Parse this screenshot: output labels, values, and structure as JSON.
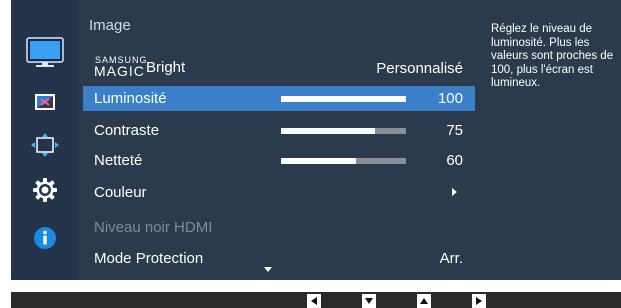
{
  "menu": {
    "title": "Image",
    "magic_bright": {
      "samsung": "SAMSUNG",
      "magic": "MAGIC",
      "bright": "Bright",
      "value": "Personnalisé"
    },
    "items": [
      {
        "label": "Luminosité",
        "value": "100",
        "level": 1.0,
        "selected": true
      },
      {
        "label": "Contraste",
        "value": "75",
        "level": 0.75
      },
      {
        "label": "Netteté",
        "value": "60",
        "level": 0.6
      },
      {
        "label": "Couleur"
      },
      {
        "label": "Niveau noir HDMI",
        "disabled": true
      },
      {
        "label": "Mode Protection",
        "value": "Arr."
      }
    ]
  },
  "help_text": "Réglez le niveau de luminosité. Plus les valeurs sont proches de 100, plus l'écran est lumineux.",
  "sidebar": {
    "icons": [
      "picture-icon",
      "color-screen-icon",
      "size-position-icon",
      "settings-gear-icon",
      "info-icon"
    ]
  },
  "colors": {
    "panel": "#2b3a4d",
    "sidebar": "#24344a",
    "selection": "#3a7fc8",
    "accent_blue": "#1a8be0"
  },
  "bottom_bar": {
    "buttons": [
      "left-arrow-icon",
      "down-arrow-icon",
      "up-arrow-icon",
      "right-arrow-icon"
    ]
  }
}
